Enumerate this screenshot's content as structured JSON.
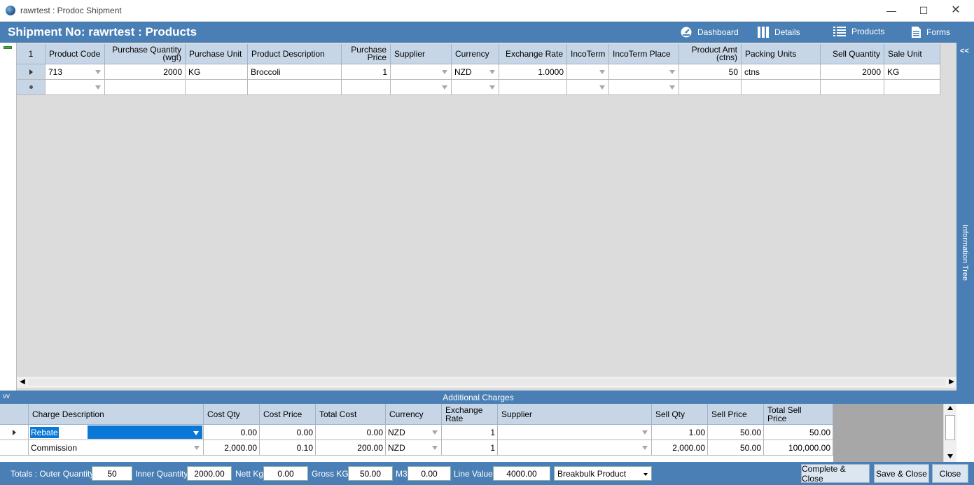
{
  "window": {
    "title": "rawrtest : Prodoc Shipment",
    "minimize": "—",
    "maximize": "☐",
    "close": "✕"
  },
  "header": {
    "title": "Shipment No: rawrtest : Products",
    "nav": {
      "dashboard": "Dashboard",
      "details": "Details",
      "products": "Products",
      "forms": "Forms"
    }
  },
  "products_grid": {
    "corner": "1",
    "columns": [
      "Product Code",
      "Purchase Quantity (wgt)",
      "Purchase Unit",
      "Product Description",
      "Purchase Price",
      "Supplier",
      "Currency",
      "Exchange Rate",
      "IncoTerm",
      "IncoTerm Place",
      "Product Amt (ctns)",
      "Packing Units",
      "Sell Quantity",
      "Sale Unit"
    ],
    "column_lines": {
      "purchase_qty_1": "Purchase Quantity",
      "purchase_qty_2": "(wgt)",
      "purchase_price_1": "Purchase",
      "purchase_price_2": "Price",
      "product_amt_1": "Product Amt",
      "product_amt_2": "(ctns)"
    },
    "rows": [
      {
        "product_code": "713",
        "purchase_quantity": "2000",
        "purchase_unit": "KG",
        "product_description": "Broccoli",
        "purchase_price": "1",
        "supplier": "",
        "currency": "NZD",
        "exchange_rate": "1.0000",
        "incoterm": "",
        "incoterm_place": "",
        "product_amt": "50",
        "packing_units": "ctns",
        "sell_quantity": "2000",
        "sale_unit": "KG"
      }
    ]
  },
  "info_tree": {
    "collapse": "<<",
    "label": "Information Tree"
  },
  "additional_charges": {
    "toggle": "vv",
    "title": "Additional Charges",
    "columns": {
      "charge_description": "Charge Description",
      "cost_qty": "Cost Qty",
      "cost_price": "Cost Price",
      "total_cost": "Total Cost",
      "currency": "Currency",
      "exchange_rate_1": "Exchange",
      "exchange_rate_2": "Rate",
      "supplier": "Supplier",
      "sell_qty": "Sell Qty",
      "sell_price": "Sell Price",
      "total_sell_1": "Total Sell",
      "total_sell_2": "Price"
    },
    "rows": [
      {
        "charge_description": "Rebate",
        "cost_qty": "0.00",
        "cost_price": "0.00",
        "total_cost": "0.00",
        "currency": "NZD",
        "exchange_rate": "1",
        "supplier": "",
        "sell_qty": "1.00",
        "sell_price": "50.00",
        "total_sell_price": "50.00"
      },
      {
        "charge_description": "Commission",
        "cost_qty": "2,000.00",
        "cost_price": "0.10",
        "total_cost": "200.00",
        "currency": "NZD",
        "exchange_rate": "1",
        "supplier": "",
        "sell_qty": "2,000.00",
        "sell_price": "50.00",
        "total_sell_price": "100,000.00"
      }
    ]
  },
  "totals": {
    "outer_quantity_label": "Totals : Outer Quantity",
    "outer_quantity": "50",
    "inner_quantity_label": "Inner Quantity",
    "inner_quantity": "2000.00",
    "nett_kg_label": "Nett Kg",
    "nett_kg": "0.00",
    "gross_kg_label": "Gross KG",
    "gross_kg": "50.00",
    "m3_label": "M3",
    "m3": "0.00",
    "line_value_label": "Line Value",
    "line_value": "4000.00",
    "product_type": "Breakbulk Product"
  },
  "buttons": {
    "complete_close": "Complete & Close",
    "save_close": "Save & Close",
    "close": "Close"
  },
  "colors": {
    "header_blue": "#4a7fb5",
    "grid_header": "#c7d6e6",
    "selection": "#0a78d7"
  }
}
